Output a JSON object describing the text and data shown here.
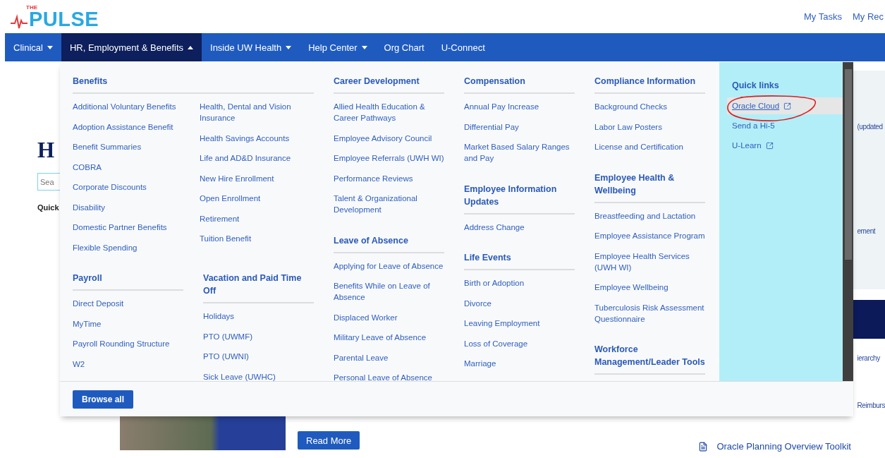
{
  "header": {
    "logo": {
      "small": "THE",
      "main": "PULSE"
    },
    "top_links": [
      "My Tasks",
      "My Rec"
    ]
  },
  "nav": {
    "items": [
      {
        "label": "Clinical",
        "dropdown": true,
        "selected": false
      },
      {
        "label": "HR, Employment & Benefits",
        "dropdown": true,
        "selected": true
      },
      {
        "label": "Inside UW Health",
        "dropdown": true,
        "selected": false
      },
      {
        "label": "Help Center",
        "dropdown": true,
        "selected": false
      },
      {
        "label": "Org Chart",
        "dropdown": false,
        "selected": false
      },
      {
        "label": "U-Connect",
        "dropdown": false,
        "selected": false
      }
    ]
  },
  "page": {
    "hero_heading": "H",
    "search": {
      "placeholder": "Sea"
    },
    "quick_label": "Quick",
    "read_more_button": "Read More",
    "sidebar_fragments": [
      "(updated",
      "ement",
      "ierarchy",
      "Reimburs"
    ],
    "sidebar_link": "Oracle Planning Overview Toolkit"
  },
  "mega_menu": {
    "columns": [
      {
        "rows": [
          [
            {
              "title": "Benefits",
              "link_columns": [
                [
                  "Additional Voluntary Benefits",
                  "Adoption Assistance Benefit",
                  "Benefit Summaries",
                  "COBRA",
                  "Corporate Discounts",
                  "Disability",
                  "Domestic Partner Benefits",
                  "Flexible Spending"
                ],
                [
                  "Health, Dental and Vision Insurance",
                  "Health Savings Accounts",
                  "Life and AD&D Insurance",
                  "New Hire Enrollment",
                  "Open Enrollment",
                  "Retirement",
                  "Tuition Benefit"
                ]
              ]
            }
          ],
          [
            {
              "title": "Payroll",
              "link_columns": [
                [
                  "Direct Deposit",
                  "MyTime",
                  "Payroll Rounding Structure",
                  "W2"
                ]
              ]
            },
            {
              "title": "Vacation and Paid Time Off",
              "link_columns": [
                [
                  "Holidays",
                  "PTO (UWMF)",
                  "PTO (UWNI)",
                  "Sick Leave (UWHC)"
                ]
              ]
            }
          ]
        ]
      },
      {
        "rows": [
          [
            {
              "title": "Career Development",
              "link_columns": [
                [
                  "Allied Health Education & Career Pathways",
                  "Employee Advisory Council",
                  "Employee Referrals (UWH WI)",
                  "Performance Reviews",
                  "Talent & Organizational Development"
                ]
              ]
            }
          ],
          [
            {
              "title": "Leave of Absence",
              "link_columns": [
                [
                  "Applying for Leave of Absence",
                  "Benefits While on Leave of Absence",
                  "Displaced Worker",
                  "Military Leave of Absence",
                  "Parental Leave",
                  "Personal Leave of Absence"
                ]
              ]
            }
          ]
        ]
      },
      {
        "rows": [
          [
            {
              "title": "Compensation",
              "link_columns": [
                [
                  "Annual Pay Increase",
                  "Differential Pay",
                  "Market Based Salary Ranges and Pay"
                ]
              ]
            }
          ],
          [
            {
              "title": "Employee Information Updates",
              "link_columns": [
                [
                  "Address Change"
                ]
              ]
            }
          ],
          [
            {
              "title": "Life Events",
              "link_columns": [
                [
                  "Birth or Adoption",
                  "Divorce",
                  "Leaving Employment",
                  "Loss of Coverage",
                  "Marriage"
                ]
              ]
            }
          ]
        ]
      },
      {
        "rows": [
          [
            {
              "title": "Compliance Information",
              "link_columns": [
                [
                  "Background Checks",
                  "Labor Law Posters",
                  "License and Certification"
                ]
              ]
            }
          ],
          [
            {
              "title": "Employee Health & Wellbeing",
              "link_columns": [
                [
                  "Breastfeeding and Lactation",
                  "Employee Assistance Program",
                  "Employee Health Services (UWH WI)",
                  "Employee Wellbeing",
                  "Tuberculosis Risk Assessment Questionnaire"
                ]
              ]
            }
          ],
          [
            {
              "title": "Workforce Management/Leader Tools"
            }
          ]
        ]
      }
    ],
    "quick_links": {
      "title": "Quick links",
      "links": [
        {
          "label": "Oracle Cloud",
          "external": true,
          "highlighted": true,
          "circled": true
        },
        {
          "label": "Send a Hi-5",
          "external": false,
          "highlighted": false,
          "circled": false
        },
        {
          "label": "U-Learn",
          "external": true,
          "highlighted": false,
          "circled": false
        }
      ]
    },
    "browse_button": "Browse all"
  }
}
